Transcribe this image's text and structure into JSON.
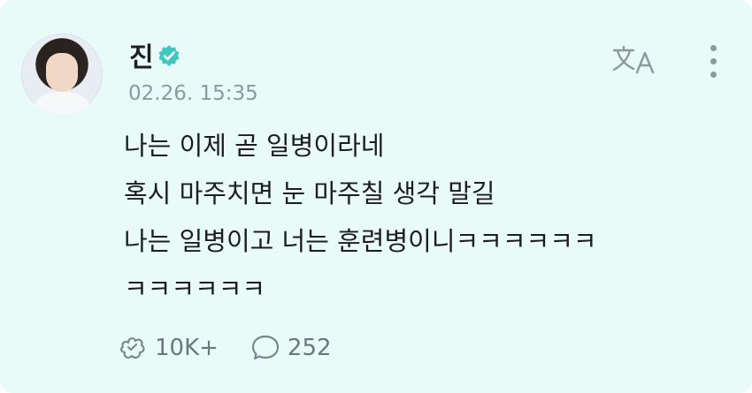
{
  "post": {
    "author": "진",
    "timestamp": "02.26. 15:35",
    "lines": [
      "나는 이제 곧 일병이라네",
      "혹시 마주치면 눈 마주칠 생각 말길",
      "나는 일병이고 너는 훈련병이니ㅋㅋㅋㅋㅋㅋ",
      "ㅋㅋㅋㅋㅋㅋ"
    ],
    "likes": "10K+",
    "comments": "252"
  },
  "icons": {
    "verified": "verified-badge-icon",
    "translate": "translate-icon",
    "more": "more-vertical-icon",
    "like": "like-icon",
    "comment": "comment-icon"
  },
  "colors": {
    "background": "#e9fbf8",
    "verified": "#3fc7c0",
    "muted": "#8c9aa0"
  }
}
